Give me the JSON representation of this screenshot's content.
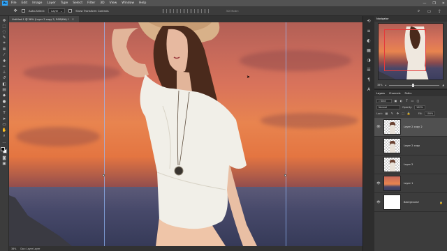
{
  "menubar": {
    "logo": "Ps",
    "items": [
      "File",
      "Edit",
      "Image",
      "Layer",
      "Type",
      "Select",
      "Filter",
      "3D",
      "View",
      "Window",
      "Help"
    ],
    "window_controls": [
      "—",
      "❐",
      "✕"
    ]
  },
  "options": {
    "auto_select_label": "Auto-Select:",
    "auto_select_value": "Layer",
    "show_transform_label": "Show Transform Controls",
    "mode_label": "3D Mode:"
  },
  "document": {
    "tab_title": "Untitled-1 @ 38% (Layer 2 copy 2, RGB/8#) *",
    "close": "✕"
  },
  "status": {
    "zoom": "38%",
    "info": "Doc: Layer Layer"
  },
  "navigator": {
    "tabs": [
      "Navigator"
    ],
    "zoom": "38%"
  },
  "layers": {
    "tabs": [
      "Layers",
      "Channels",
      "Paths"
    ],
    "filter_kind": "Kind",
    "blend_mode": "Normal",
    "opacity_label": "Opacity:",
    "opacity_value": "100%",
    "lock_label": "Lock:",
    "fill_label": "Fill:",
    "fill_value": "100%",
    "items": [
      {
        "name": "Layer 2 copy 2",
        "visible": true,
        "selected": true,
        "thumb": "checker"
      },
      {
        "name": "Layer 2 copy",
        "visible": false,
        "selected": false,
        "thumb": "checker"
      },
      {
        "name": "Layer 2",
        "visible": false,
        "selected": false,
        "thumb": "checker"
      },
      {
        "name": "Layer 1",
        "visible": true,
        "selected": false,
        "thumb": "sunset"
      },
      {
        "name": "Background",
        "visible": true,
        "selected": false,
        "thumb": "white",
        "locked": true
      }
    ]
  },
  "colors": {
    "accent": "#31a8ff",
    "foreground": "#000000",
    "background": "#ffffff",
    "navigator_view_box": "#e53b3b"
  }
}
